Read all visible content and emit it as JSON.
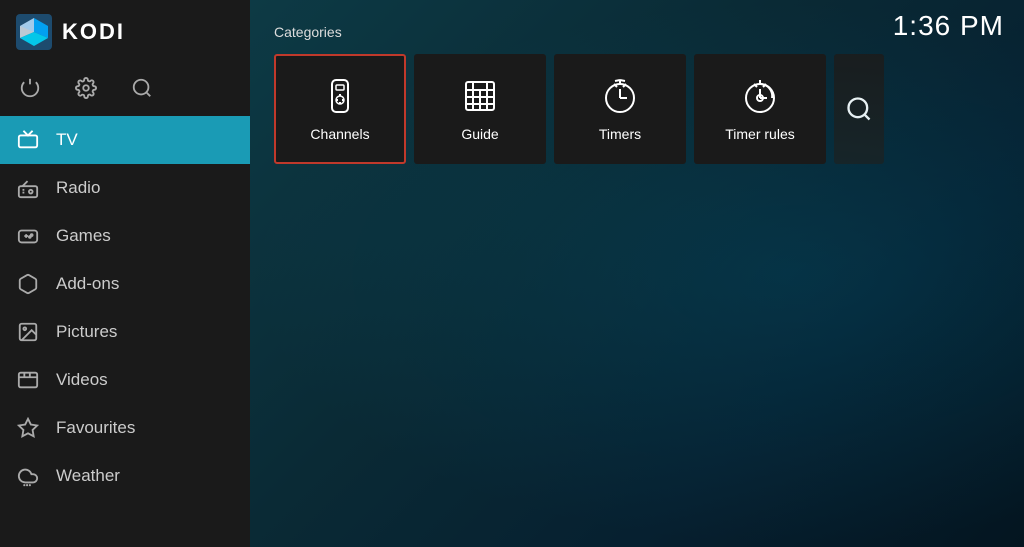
{
  "app": {
    "title": "KODI",
    "time": "1:36 PM"
  },
  "sidebar": {
    "icons": [
      {
        "name": "power-icon",
        "symbol": "⏻",
        "label": "Power"
      },
      {
        "name": "settings-icon",
        "symbol": "⚙",
        "label": "Settings"
      },
      {
        "name": "search-icon",
        "symbol": "🔍",
        "label": "Search"
      }
    ],
    "nav_items": [
      {
        "id": "tv",
        "label": "TV",
        "active": true
      },
      {
        "id": "radio",
        "label": "Radio",
        "active": false
      },
      {
        "id": "games",
        "label": "Games",
        "active": false
      },
      {
        "id": "add-ons",
        "label": "Add-ons",
        "active": false
      },
      {
        "id": "pictures",
        "label": "Pictures",
        "active": false
      },
      {
        "id": "videos",
        "label": "Videos",
        "active": false
      },
      {
        "id": "favourites",
        "label": "Favourites",
        "active": false
      },
      {
        "id": "weather",
        "label": "Weather",
        "active": false
      }
    ]
  },
  "main": {
    "categories_label": "Categories",
    "cards": [
      {
        "id": "channels",
        "label": "Channels",
        "selected": true
      },
      {
        "id": "guide",
        "label": "Guide",
        "selected": false
      },
      {
        "id": "timers",
        "label": "Timers",
        "selected": false
      },
      {
        "id": "timer-rules",
        "label": "Timer rules",
        "selected": false
      },
      {
        "id": "search",
        "label": "Search",
        "partial": true
      }
    ]
  },
  "colors": {
    "active_bg": "#1a9bb5",
    "selected_border": "#c0392b",
    "card_bg": "#1c1c1c",
    "sidebar_bg": "#1a1a1a"
  }
}
